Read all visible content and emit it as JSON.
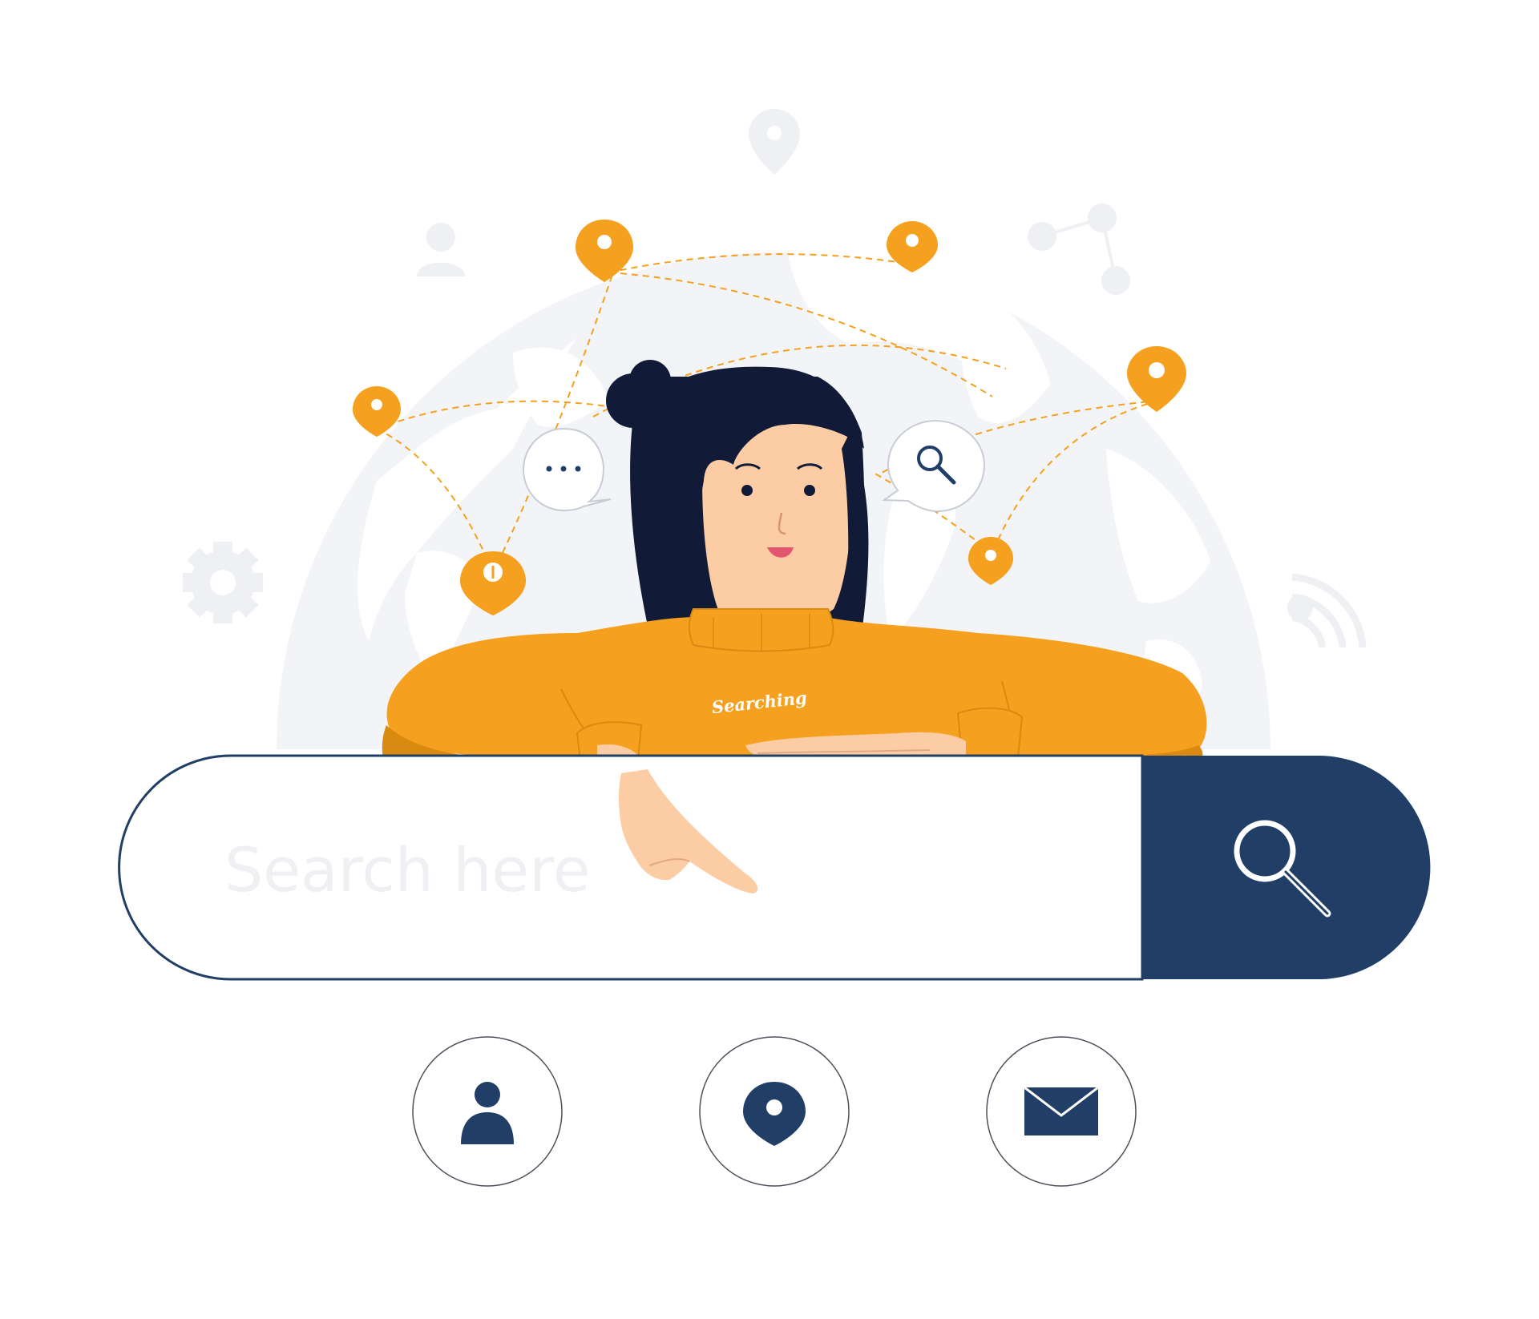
{
  "search": {
    "placeholder": "Search here",
    "button_icon": "search-icon"
  },
  "character": {
    "sweater_text": "Searching"
  },
  "bottom_icons": [
    {
      "icon": "user-icon"
    },
    {
      "icon": "location-pin-icon"
    },
    {
      "icon": "mail-icon"
    }
  ],
  "background_icons": [
    "user-icon",
    "gear-icon",
    "share-icon",
    "wifi-icon",
    "location-pin-icon",
    "globe-icon"
  ],
  "colors": {
    "navy": "#213f66",
    "orange": "#f5a01e",
    "light_gray": "#eff0f4",
    "skin": "#fccda4",
    "hair": "#111a36",
    "white": "#ffffff"
  }
}
